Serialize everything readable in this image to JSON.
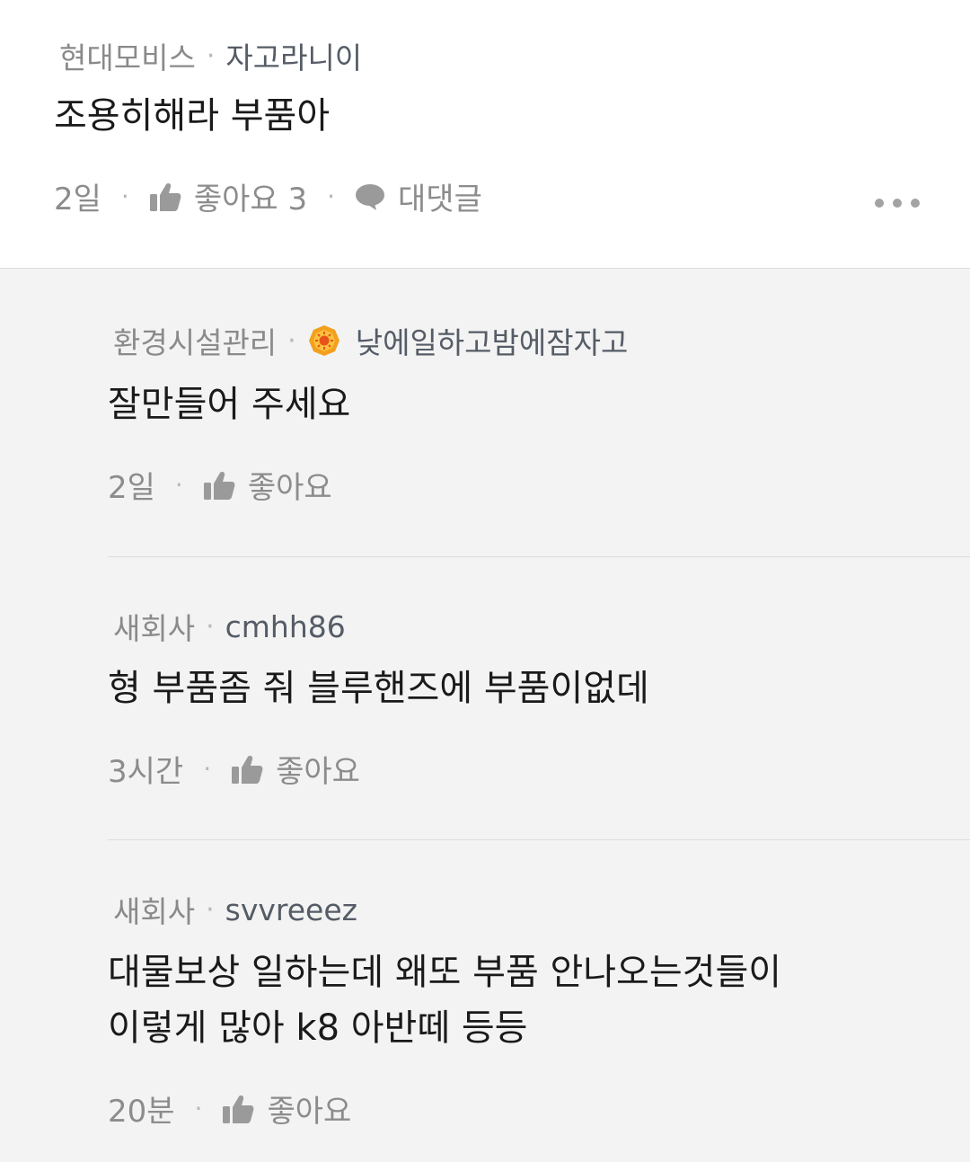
{
  "top_comment": {
    "company": "현대모비스",
    "separator": "·",
    "nickname": "자고라니이",
    "content": "조용히해라 부품아",
    "time": "2일",
    "like_label": "좋아요 3",
    "reply_label": "대댓글",
    "more_icon": "more-dots-icon"
  },
  "replies": [
    {
      "company": "환경시설관리",
      "nickname": "낮에일하고밤에잠자고",
      "has_badge": true,
      "badge_icon": "sun-badge-icon",
      "content_lines": [
        "잘만들어 주세요"
      ],
      "time": "2일",
      "like_label": "좋아요"
    },
    {
      "company": "새회사",
      "nickname": "cmhh86",
      "content_lines": [
        "형 부품좀 줘 블루핸즈에 부품이없데"
      ],
      "time": "3시간",
      "like_label": "좋아요"
    },
    {
      "company": "새회사",
      "nickname": "svvreeez",
      "content_lines": [
        "대물보상 일하는데 왜또 부품 안나오는것들이",
        "이렇게 많아 k8 아반떼 등등"
      ],
      "time": "20분",
      "like_label": "좋아요"
    }
  ],
  "colors": {
    "reply_background": "#f3f3f3",
    "badge_orange": "#f2a01e",
    "meta_gray": "#8a8a8a"
  }
}
